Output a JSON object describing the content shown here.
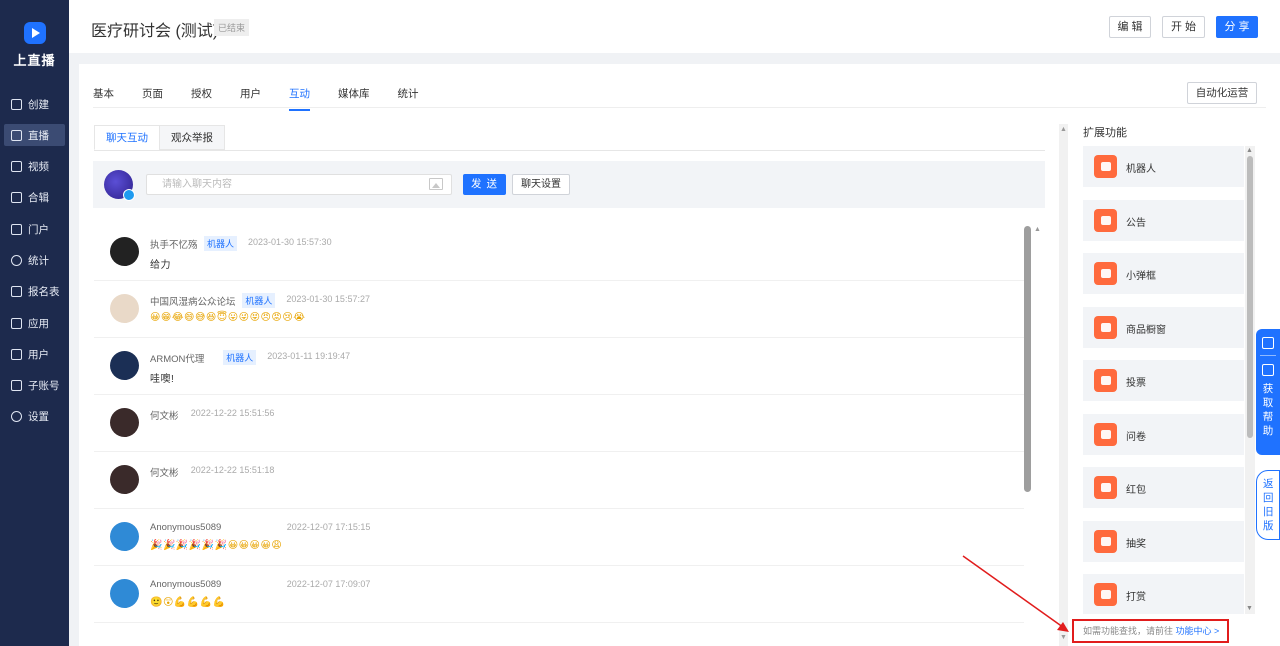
{
  "app": {
    "logo_text": "上直播"
  },
  "sidebar": {
    "items": [
      {
        "label": "创建",
        "icon": "plus-square-icon"
      },
      {
        "label": "直播",
        "icon": "video-camera-icon"
      },
      {
        "label": "视频",
        "icon": "film-icon"
      },
      {
        "label": "合辑",
        "icon": "collection-icon"
      },
      {
        "label": "门户",
        "icon": "monitor-icon"
      },
      {
        "label": "统计",
        "icon": "pie-chart-icon"
      },
      {
        "label": "报名表",
        "icon": "form-icon"
      },
      {
        "label": "应用",
        "icon": "apps-grid-icon"
      },
      {
        "label": "用户",
        "icon": "user-icon"
      },
      {
        "label": "子账号",
        "icon": "sub-account-icon"
      },
      {
        "label": "设置",
        "icon": "gear-icon"
      }
    ],
    "active_index": 1
  },
  "header": {
    "title": "医疗研讨会 (测试)",
    "status": "已结束",
    "edit_label": "编 辑",
    "start_label": "开 始",
    "share_label": "分 享"
  },
  "tabs": [
    "基本",
    "页面",
    "授权",
    "用户",
    "互动",
    "媒体库",
    "统计"
  ],
  "active_tab": 4,
  "auto_ops_label": "自动化运营",
  "subtabs": [
    "聊天互动",
    "观众举报"
  ],
  "composer": {
    "placeholder": "请输入聊天内容",
    "send_label": "发 送",
    "settings_label": "聊天设置"
  },
  "messages": [
    {
      "name": "执手不忆殇",
      "tag": "机器人",
      "time": "2023-01-30 15:57:30",
      "text": "给力",
      "emoji": "",
      "avatar_color": "#222"
    },
    {
      "name": "中国风湿病公众论坛",
      "tag": "机器人",
      "time": "2023-01-30 15:57:27",
      "text": "",
      "emoji": "😀😁😂😄😅😆😇😛😜😝😠😡😢😭",
      "avatar_color": "#e9d9c8"
    },
    {
      "name": "ARMON代理",
      "tag": "机器人",
      "time": "2023-01-11 19:19:47",
      "text": "哇噢!",
      "emoji": "",
      "avatar_color": "#1b2f55"
    },
    {
      "name": "何文彬",
      "tag": "",
      "time": "2022-12-22 15:51:56",
      "text": "",
      "emoji": "",
      "avatar_color": "#3a2a2a"
    },
    {
      "name": "何文彬",
      "tag": "",
      "time": "2022-12-22 15:51:18",
      "text": "",
      "emoji": "",
      "avatar_color": "#3a2a2a"
    },
    {
      "name": "Anonymous5089",
      "tag": "",
      "time": "2022-12-07 17:15:15",
      "text": "",
      "emoji": "🎉🎉🎉🎉🎉🎉😀😀😀😀😩",
      "avatar_color": "#2f8ad6"
    },
    {
      "name": "Anonymous5089",
      "tag": "",
      "time": "2022-12-07 17:09:07",
      "text": "",
      "emoji": "🙂😲💪💪💪💪",
      "avatar_color": "#2f8ad6"
    }
  ],
  "extensions": {
    "title": "扩展功能",
    "items": [
      {
        "label": "机器人",
        "icon": "robot-icon"
      },
      {
        "label": "公告",
        "icon": "megaphone-icon"
      },
      {
        "label": "小弹框",
        "icon": "popup-icon"
      },
      {
        "label": "商品橱窗",
        "icon": "cart-icon"
      },
      {
        "label": "投票",
        "icon": "vote-icon"
      },
      {
        "label": "问卷",
        "icon": "survey-icon"
      },
      {
        "label": "红包",
        "icon": "red-packet-icon"
      },
      {
        "label": "抽奖",
        "icon": "lottery-icon"
      },
      {
        "label": "打赏",
        "icon": "reward-icon"
      }
    ],
    "hint_text": "如需功能查找，请前往",
    "hint_link": "功能中心 >"
  },
  "floating": {
    "help_label": "获取帮助",
    "back_old_label": "返回旧版"
  },
  "colors": {
    "sidebar_bg": "#1d2a4d",
    "accent": "#1f72ff",
    "ext_icon": "#ff6a3d",
    "highlight": "#e11c1c"
  }
}
